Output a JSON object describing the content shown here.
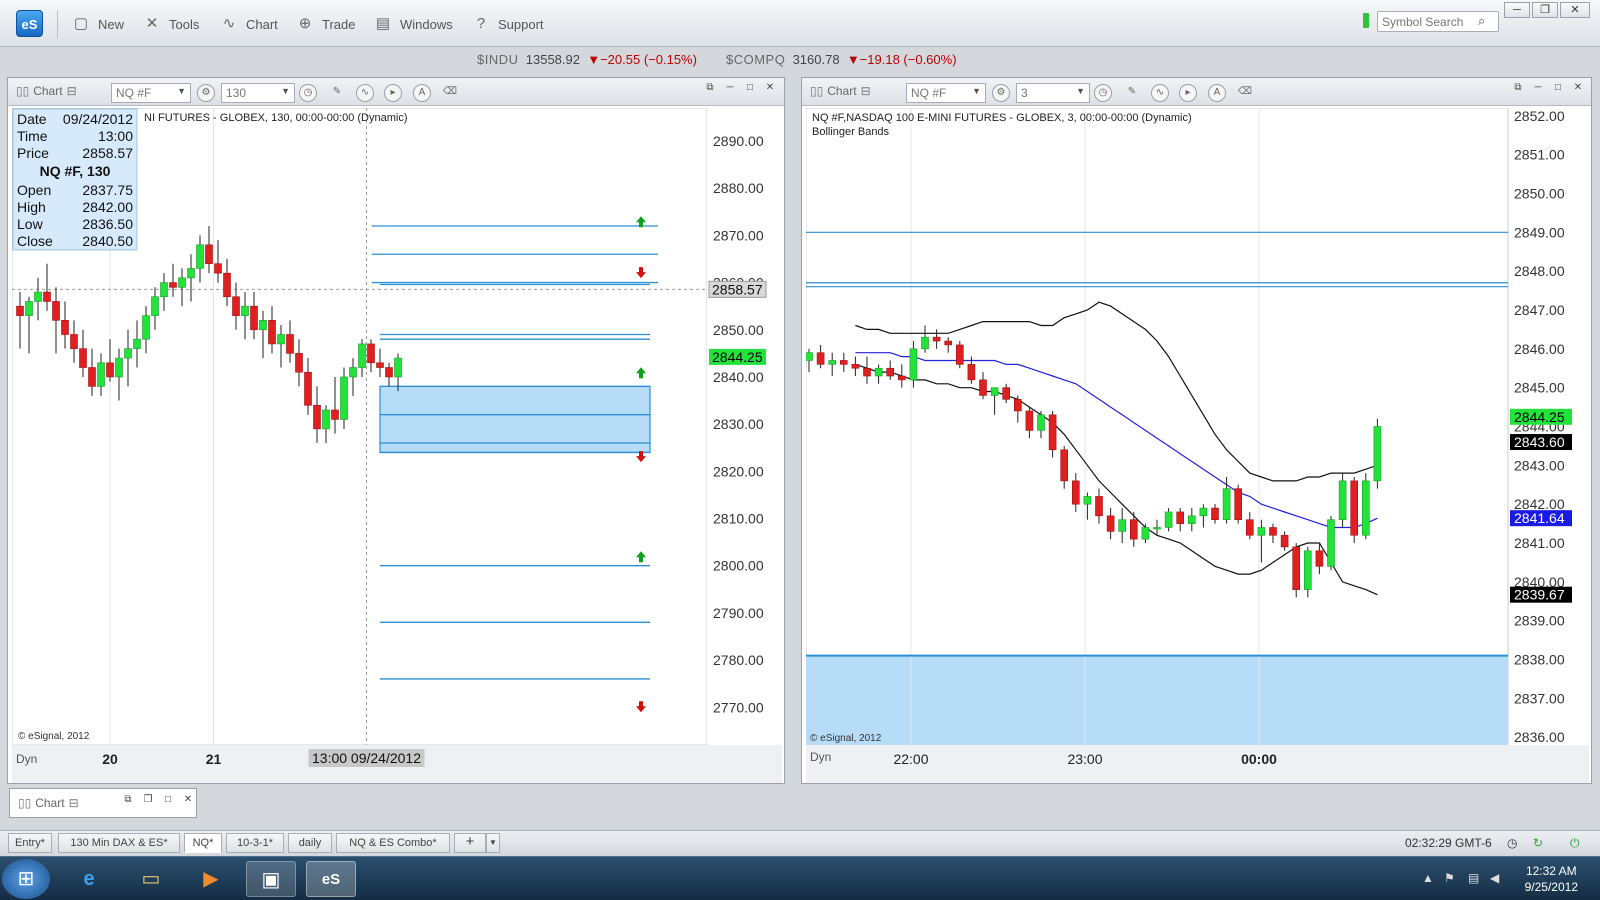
{
  "app": {
    "logo": "eS",
    "window_controls": [
      "─",
      "❐",
      "✕"
    ]
  },
  "toolbar": {
    "items": [
      {
        "label": "New",
        "icon": "new-document-icon"
      },
      {
        "label": "Tools",
        "icon": "tools-icon"
      },
      {
        "label": "Chart",
        "icon": "chart-icon"
      },
      {
        "label": "Trade",
        "icon": "trade-icon"
      },
      {
        "label": "Windows",
        "icon": "windows-icon"
      },
      {
        "label": "Support",
        "icon": "help-icon"
      }
    ],
    "search_placeholder": "Symbol Search"
  },
  "ticker": {
    "items": [
      {
        "symbol": "$INDU",
        "price": "13558.92",
        "change": "▼−20.55 (−0.15%)"
      },
      {
        "symbol": "$COMPQ",
        "price": "3160.78",
        "change": "▼−19.18 (−0.60%)"
      }
    ]
  },
  "left_chart": {
    "title": "Chart",
    "symbol": "NQ #F",
    "interval": "130",
    "header_text": "NI FUTURES - GLOBEX, 130, 00:00-00:00 (Dynamic)",
    "copyright": "© eSignal, 2012",
    "dyn": "Dyn",
    "cursor_label": "13:00 09/24/2012",
    "x_labels": [
      "20",
      "21"
    ],
    "price_tag_cursor": "2858.57",
    "price_tag_last": "2844.25",
    "info": {
      "rows1": [
        [
          "Date",
          "09/24/2012"
        ],
        [
          "Time",
          "13:00"
        ],
        [
          "Price",
          "2858.57"
        ]
      ],
      "symbol": "NQ #F, 130",
      "rows2": [
        [
          "Open",
          "2837.75"
        ],
        [
          "High",
          "2842.00"
        ],
        [
          "Low",
          "2836.50"
        ],
        [
          "Close",
          "2840.50"
        ]
      ]
    }
  },
  "right_chart": {
    "title": "Chart",
    "symbol": "NQ #F",
    "interval": "3",
    "header_text": "NQ #F,NASDAQ 100 E-MINI FUTURES - GLOBEX, 3, 00:00-00:00 (Dynamic)",
    "study": "Bollinger Bands",
    "copyright": "© eSignal, 2012",
    "dyn": "Dyn",
    "x_labels": [
      "22:00",
      "23:00",
      "00:00"
    ],
    "tags": [
      {
        "text": "2844.25",
        "color": "#22e33a",
        "fg": "#000"
      },
      {
        "text": "2843.60",
        "color": "#000000",
        "fg": "#fff"
      },
      {
        "text": "2841.64",
        "color": "#1a1ae6",
        "fg": "#fff"
      },
      {
        "text": "2839.67",
        "color": "#000000",
        "fg": "#fff"
      }
    ]
  },
  "chart_data": [
    {
      "type": "candlestick",
      "symbol": "NQ #F",
      "interval": "130",
      "ylim": [
        2762,
        2897
      ],
      "y_ticks": [
        "2890.00",
        "2880.00",
        "2870.00",
        "2860.00",
        "2850.00",
        "2840.00",
        "2830.00",
        "2820.00",
        "2810.00",
        "2800.00",
        "2790.00",
        "2780.00",
        "2770.00"
      ],
      "x_ticks": [
        "20",
        "21"
      ],
      "candles": [
        [
          2855,
          2858,
          2846,
          2853
        ],
        [
          2853,
          2857,
          2845,
          2856
        ],
        [
          2856,
          2861,
          2852,
          2858
        ],
        [
          2858,
          2864,
          2854,
          2856
        ],
        [
          2856,
          2859,
          2845,
          2852
        ],
        [
          2852,
          2856,
          2846,
          2849
        ],
        [
          2849,
          2852,
          2843,
          2846
        ],
        [
          2846,
          2850,
          2840,
          2842
        ],
        [
          2842,
          2846,
          2836,
          2838
        ],
        [
          2838,
          2845,
          2836,
          2843
        ],
        [
          2843,
          2848,
          2839,
          2840
        ],
        [
          2840,
          2846,
          2835,
          2844
        ],
        [
          2844,
          2850,
          2838,
          2846
        ],
        [
          2846,
          2852,
          2842,
          2848
        ],
        [
          2848,
          2855,
          2845,
          2853
        ],
        [
          2853,
          2859,
          2850,
          2857
        ],
        [
          2857,
          2862,
          2854,
          2860
        ],
        [
          2860,
          2864,
          2857,
          2859
        ],
        [
          2859,
          2863,
          2855,
          2861
        ],
        [
          2861,
          2866,
          2856,
          2863
        ],
        [
          2863,
          2870,
          2860,
          2868
        ],
        [
          2868,
          2872,
          2862,
          2864
        ],
        [
          2864,
          2869,
          2860,
          2862
        ],
        [
          2862,
          2865,
          2855,
          2857
        ],
        [
          2857,
          2860,
          2850,
          2853
        ],
        [
          2853,
          2858,
          2848,
          2855
        ],
        [
          2855,
          2858,
          2848,
          2850
        ],
        [
          2850,
          2854,
          2844,
          2852
        ],
        [
          2852,
          2855,
          2845,
          2847
        ],
        [
          2847,
          2851,
          2842,
          2849
        ],
        [
          2849,
          2852,
          2843,
          2845
        ],
        [
          2845,
          2848,
          2838,
          2841
        ],
        [
          2841,
          2844,
          2832,
          2834
        ],
        [
          2834,
          2838,
          2826,
          2829
        ],
        [
          2829,
          2834,
          2826,
          2833
        ],
        [
          2833,
          2840,
          2828,
          2831
        ],
        [
          2831,
          2842,
          2829,
          2840
        ],
        [
          2840,
          2844,
          2836,
          2842
        ],
        [
          2842,
          2848,
          2840,
          2847
        ],
        [
          2847,
          2848,
          2841,
          2843
        ],
        [
          2843,
          2846,
          2840,
          2842
        ],
        [
          2842,
          2843,
          2838,
          2840
        ],
        [
          2840,
          2845,
          2837,
          2844
        ]
      ],
      "levels": [
        2872,
        2866,
        2860,
        2859.6,
        2849,
        2848,
        2838,
        2832,
        2826,
        2824,
        2800,
        2788,
        2776
      ],
      "zone": [
        2824,
        2838
      ],
      "arrows": [
        {
          "y": 2873,
          "dir": "up"
        },
        {
          "y": 2862,
          "dir": "down"
        },
        {
          "y": 2841,
          "dir": "up"
        },
        {
          "y": 2823,
          "dir": "down"
        },
        {
          "y": 2802,
          "dir": "up"
        },
        {
          "y": 2770,
          "dir": "down"
        }
      ],
      "cursor_value": 2858.57
    },
    {
      "type": "candlestick",
      "symbol": "NQ #F",
      "interval": "3",
      "ylim": [
        2835.8,
        2852.2
      ],
      "y_ticks": [
        "2852.00",
        "2851.00",
        "2850.00",
        "2849.00",
        "2848.00",
        "2847.00",
        "2846.00",
        "2845.00",
        "2844.00",
        "2843.00",
        "2842.00",
        "2841.00",
        "2840.00",
        "2839.00",
        "2838.00",
        "2837.00",
        "2836.00"
      ],
      "x_ticks": [
        "22:00",
        "23:00",
        "00:00"
      ],
      "candles": [
        [
          2845.7,
          2846.0,
          2845.4,
          2845.9
        ],
        [
          2845.9,
          2846.1,
          2845.5,
          2845.6
        ],
        [
          2845.6,
          2845.9,
          2845.3,
          2845.7
        ],
        [
          2845.7,
          2845.9,
          2845.4,
          2845.6
        ],
        [
          2845.6,
          2845.8,
          2845.3,
          2845.5
        ],
        [
          2845.5,
          2845.8,
          2845.1,
          2845.3
        ],
        [
          2845.3,
          2845.6,
          2845.1,
          2845.5
        ],
        [
          2845.5,
          2845.7,
          2845.2,
          2845.3
        ],
        [
          2845.3,
          2845.6,
          2845.0,
          2845.2
        ],
        [
          2845.2,
          2846.2,
          2845.0,
          2846.0
        ],
        [
          2846.0,
          2846.6,
          2845.9,
          2846.3
        ],
        [
          2846.3,
          2846.5,
          2846.0,
          2846.2
        ],
        [
          2846.2,
          2846.3,
          2845.9,
          2846.1
        ],
        [
          2846.1,
          2846.2,
          2845.5,
          2845.6
        ],
        [
          2845.6,
          2845.8,
          2845.1,
          2845.2
        ],
        [
          2845.2,
          2845.4,
          2844.7,
          2844.8
        ],
        [
          2844.8,
          2845.0,
          2844.3,
          2845.0
        ],
        [
          2845.0,
          2845.1,
          2844.6,
          2844.7
        ],
        [
          2844.7,
          2844.8,
          2844.1,
          2844.4
        ],
        [
          2844.4,
          2844.5,
          2843.7,
          2843.9
        ],
        [
          2843.9,
          2844.4,
          2843.7,
          2844.3
        ],
        [
          2844.3,
          2844.4,
          2843.2,
          2843.4
        ],
        [
          2843.4,
          2843.5,
          2842.4,
          2842.6
        ],
        [
          2842.6,
          2842.8,
          2841.8,
          2842.0
        ],
        [
          2842.0,
          2842.3,
          2841.6,
          2842.2
        ],
        [
          2842.2,
          2842.4,
          2841.5,
          2841.7
        ],
        [
          2841.7,
          2841.9,
          2841.1,
          2841.3
        ],
        [
          2841.3,
          2841.9,
          2841.0,
          2841.6
        ],
        [
          2841.6,
          2841.8,
          2840.9,
          2841.1
        ],
        [
          2841.1,
          2841.5,
          2841.0,
          2841.4
        ],
        [
          2841.4,
          2841.6,
          2841.2,
          2841.4
        ],
        [
          2841.4,
          2841.9,
          2841.3,
          2841.8
        ],
        [
          2841.8,
          2841.9,
          2841.3,
          2841.5
        ],
        [
          2841.5,
          2841.9,
          2841.3,
          2841.7
        ],
        [
          2841.7,
          2842.0,
          2841.4,
          2841.9
        ],
        [
          2841.9,
          2842.0,
          2841.5,
          2841.6
        ],
        [
          2841.6,
          2842.7,
          2841.5,
          2842.4
        ],
        [
          2842.4,
          2842.5,
          2841.5,
          2841.6
        ],
        [
          2841.6,
          2841.8,
          2841.1,
          2841.2
        ],
        [
          2841.2,
          2841.6,
          2840.5,
          2841.4
        ],
        [
          2841.4,
          2841.5,
          2841.0,
          2841.2
        ],
        [
          2841.2,
          2841.3,
          2840.8,
          2840.9
        ],
        [
          2840.9,
          2841.0,
          2839.6,
          2839.8
        ],
        [
          2839.8,
          2840.9,
          2839.6,
          2840.8
        ],
        [
          2840.8,
          2841.0,
          2840.2,
          2840.4
        ],
        [
          2840.4,
          2841.7,
          2840.3,
          2841.6
        ],
        [
          2841.6,
          2842.8,
          2841.4,
          2842.6
        ],
        [
          2842.6,
          2842.7,
          2841.0,
          2841.2
        ],
        [
          2841.2,
          2842.8,
          2841.1,
          2842.6
        ],
        [
          2842.6,
          2844.2,
          2842.4,
          2844.0
        ]
      ],
      "bb_upper": [
        2846.6,
        2846.5,
        2846.5,
        2846.4,
        2846.4,
        2846.4,
        2846.4,
        2846.4,
        2846.4,
        2846.5,
        2846.6,
        2846.7,
        2846.7,
        2846.7,
        2846.7,
        2846.7,
        2846.6,
        2846.6,
        2846.8,
        2846.9,
        2847.0,
        2847.2,
        2847.1,
        2846.9,
        2846.7,
        2846.5,
        2846.2,
        2845.8,
        2845.3,
        2844.8,
        2844.3,
        2843.8,
        2843.4,
        2843.1,
        2842.8,
        2842.7,
        2842.6,
        2842.6,
        2842.6,
        2842.7,
        2842.7,
        2842.8,
        2842.8,
        2842.8,
        2842.9,
        2843.0
      ],
      "bb_middle": [
        2845.9,
        2845.9,
        2845.9,
        2845.9,
        2845.8,
        2845.8,
        2845.7,
        2845.7,
        2845.7,
        2845.7,
        2845.7,
        2845.7,
        2845.7,
        2845.6,
        2845.6,
        2845.5,
        2845.4,
        2845.3,
        2845.2,
        2845.1,
        2844.9,
        2844.7,
        2844.5,
        2844.3,
        2844.1,
        2843.9,
        2843.7,
        2843.5,
        2843.3,
        2843.1,
        2842.9,
        2842.7,
        2842.5,
        2842.3,
        2842.2,
        2842.0,
        2841.9,
        2841.8,
        2841.7,
        2841.6,
        2841.5,
        2841.4,
        2841.4,
        2841.4,
        2841.5,
        2841.64
      ],
      "bb_lower": [
        2845.6,
        2845.5,
        2845.4,
        2845.4,
        2845.3,
        2845.2,
        2845.2,
        2845.1,
        2845.1,
        2845.0,
        2845.0,
        2844.9,
        2844.9,
        2844.8,
        2844.7,
        2844.5,
        2844.3,
        2844.1,
        2843.8,
        2843.4,
        2843.0,
        2842.6,
        2842.3,
        2842.0,
        2841.7,
        2841.4,
        2841.2,
        2841.1,
        2841.0,
        2840.8,
        2840.6,
        2840.4,
        2840.3,
        2840.2,
        2840.2,
        2840.3,
        2840.5,
        2840.7,
        2840.9,
        2841.0,
        2841.0,
        2840.5,
        2840.0,
        2839.9,
        2839.8,
        2839.67
      ],
      "levels": [
        2849.0,
        2847.7,
        2847.6,
        2838.1
      ],
      "zone": [
        2835.8,
        2838.1
      ]
    }
  ],
  "bottom_panel": {
    "title": "Chart"
  },
  "tabs": [
    {
      "label": "Entry*"
    },
    {
      "label": "130 Min DAX & ES*"
    },
    {
      "label": "NQ*",
      "active": true
    },
    {
      "label": "10-3-1*"
    },
    {
      "label": "daily"
    },
    {
      "label": "NQ & ES Combo*"
    }
  ],
  "status": {
    "time": "02:32:29 GMT-6"
  },
  "taskbar": {
    "clock_time": "12:32 AM",
    "clock_date": "9/25/2012"
  },
  "colors": {
    "up": "#22e33a",
    "down": "#e02020",
    "level": "#2a8fd6",
    "zone": "#b7dcf7",
    "accent": "#1768c4"
  }
}
